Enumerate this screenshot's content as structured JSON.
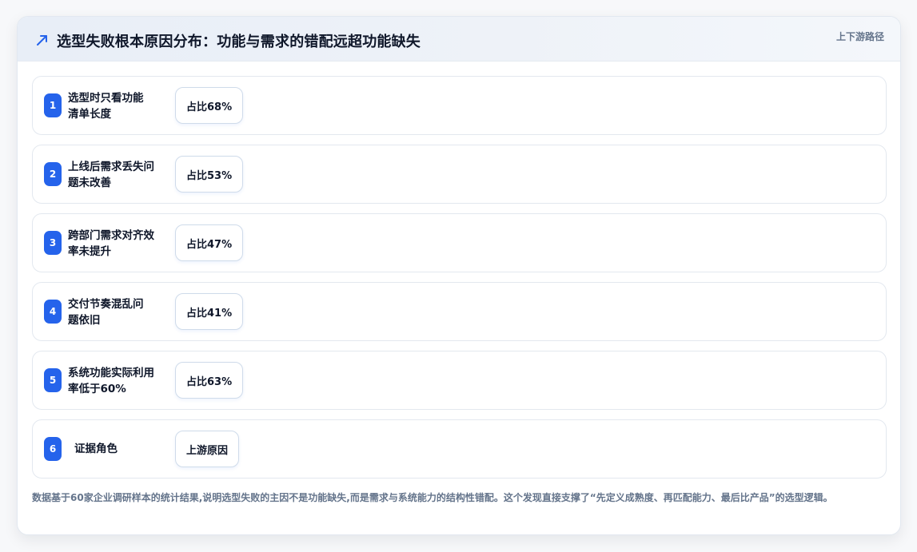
{
  "header": {
    "icon": "trend-arrow-icon",
    "title": "选型失败根本原因分布：功能与需求的错配远超功能缺失",
    "tag": "上下游路径"
  },
  "items": [
    {
      "index": "1",
      "label_line1": "选型时只看功能",
      "label_line2": "清单长度",
      "value": "占比68%"
    },
    {
      "index": "2",
      "label_line1": "上线后需求丢失问",
      "label_line2": "题未改善",
      "value": "占比53%"
    },
    {
      "index": "3",
      "label_line1": "跨部门需求对齐效",
      "label_line2": "率未提升",
      "value": "占比47%"
    },
    {
      "index": "4",
      "label_line1": "交付节奏混乱问",
      "label_line2": "题依旧",
      "value": "占比41%"
    },
    {
      "index": "5",
      "label_line1": "系统功能实际利用",
      "label_line2": "率低于60%",
      "value": "占比63%"
    },
    {
      "index": "6",
      "label_line1": "证据角色",
      "label_line2": "",
      "value": "上游原因"
    }
  ],
  "footnote": "数据基于60家企业调研样本的统计结果,说明选型失败的主因不是功能缺失,而是需求与系统能力的结构性错配。这个发现直接支撑了“先定义成熟度、再匹配能力、最后比产品”的选型逻辑。",
  "colors": {
    "accent": "#2563eb",
    "title": "#0f172a",
    "muted": "#64748b"
  }
}
